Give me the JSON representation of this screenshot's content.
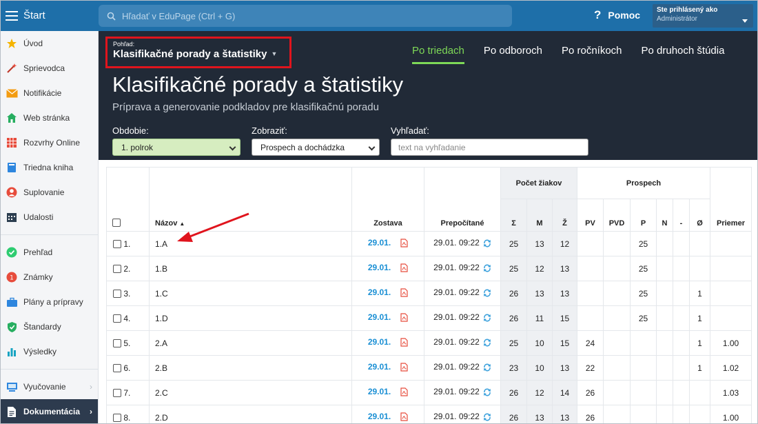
{
  "topbar": {
    "start_label": "Štart",
    "search_placeholder": "Hľadať v EduPage (Ctrl + G)",
    "help_label": "Pomoc",
    "user_line1": "Ste prihlásený ako",
    "user_line2": "Administrátor"
  },
  "sidebar": {
    "items": [
      {
        "label": "Úvod",
        "icon": "star-icon"
      },
      {
        "label": "Sprievodca",
        "icon": "wand-icon"
      },
      {
        "label": "Notifikácie",
        "icon": "envelope-icon"
      },
      {
        "label": "Web stránka",
        "icon": "house-icon"
      },
      {
        "label": "Rozvrhy Online",
        "icon": "timetable-icon"
      },
      {
        "label": "Triedna kniha",
        "icon": "book-icon"
      },
      {
        "label": "Suplovanie",
        "icon": "person-icon"
      },
      {
        "label": "Udalosti",
        "icon": "calendar-icon"
      },
      {
        "label": "Prehľad",
        "icon": "check-circle-icon"
      },
      {
        "label": "Známky",
        "icon": "grades-icon"
      },
      {
        "label": "Plány a prípravy",
        "icon": "briefcase-icon"
      },
      {
        "label": "Štandardy",
        "icon": "shield-icon"
      },
      {
        "label": "Výsledky",
        "icon": "bar-chart-icon"
      },
      {
        "label": "Vyučovanie",
        "icon": "classroom-icon"
      },
      {
        "label": "Dokumentácia",
        "icon": "document-icon"
      }
    ]
  },
  "header": {
    "view_small": "Pohľad:",
    "view_title": "Klasifikačné porady a štatistiky",
    "tabs": [
      "Po triedach",
      "Po odboroch",
      "Po ročníkoch",
      "Po druhoch štúdia"
    ],
    "title": "Klasifikačné porady a štatistiky",
    "subtitle": "Príprava a generovanie podkladov pre klasifikačnú poradu",
    "filters": {
      "obdobie_label": "Obdobie:",
      "obdobie_value": "1. polrok",
      "zobrazit_label": "Zobraziť:",
      "zobrazit_value": "Prospech a dochádzka",
      "vyhladat_label": "Vyhľadať:",
      "vyhladat_placeholder": "text na vyhľadanie"
    }
  },
  "table": {
    "group_pocet": "Počet žiakov",
    "group_prospech": "Prospech",
    "columns": {
      "nazov": "Názov",
      "zostava": "Zostava",
      "prepocitane": "Prepočítané",
      "sum": "Σ",
      "m": "M",
      "z": "Ž",
      "pv": "PV",
      "pvd": "PVD",
      "p": "P",
      "n": "N",
      "dash": "-",
      "avg_sym": "Ø",
      "priemer": "Priemer"
    },
    "rows": [
      {
        "num": "1.",
        "name": "1.A",
        "zostava": "29.01.",
        "prepocitane": "29.01. 09:22",
        "sum": "25",
        "m": "13",
        "z": "12",
        "pv": "",
        "pvd": "",
        "p": "25",
        "n": "",
        "dash": "",
        "avg": "",
        "priemer": ""
      },
      {
        "num": "2.",
        "name": "1.B",
        "zostava": "29.01.",
        "prepocitane": "29.01. 09:22",
        "sum": "25",
        "m": "12",
        "z": "13",
        "pv": "",
        "pvd": "",
        "p": "25",
        "n": "",
        "dash": "",
        "avg": "",
        "priemer": ""
      },
      {
        "num": "3.",
        "name": "1.C",
        "zostava": "29.01.",
        "prepocitane": "29.01. 09:22",
        "sum": "26",
        "m": "13",
        "z": "13",
        "pv": "",
        "pvd": "",
        "p": "25",
        "n": "",
        "dash": "",
        "avg": "1",
        "priemer": ""
      },
      {
        "num": "4.",
        "name": "1.D",
        "zostava": "29.01.",
        "prepocitane": "29.01. 09:22",
        "sum": "26",
        "m": "11",
        "z": "15",
        "pv": "",
        "pvd": "",
        "p": "25",
        "n": "",
        "dash": "",
        "avg": "1",
        "priemer": ""
      },
      {
        "num": "5.",
        "name": "2.A",
        "zostava": "29.01.",
        "prepocitane": "29.01. 09:22",
        "sum": "25",
        "m": "10",
        "z": "15",
        "pv": "24",
        "pvd": "",
        "p": "",
        "n": "",
        "dash": "",
        "avg": "1",
        "priemer": "1.00"
      },
      {
        "num": "6.",
        "name": "2.B",
        "zostava": "29.01.",
        "prepocitane": "29.01. 09:22",
        "sum": "23",
        "m": "10",
        "z": "13",
        "pv": "22",
        "pvd": "",
        "p": "",
        "n": "",
        "dash": "",
        "avg": "1",
        "priemer": "1.02"
      },
      {
        "num": "7.",
        "name": "2.C",
        "zostava": "29.01.",
        "prepocitane": "29.01. 09:22",
        "sum": "26",
        "m": "12",
        "z": "14",
        "pv": "26",
        "pvd": "",
        "p": "",
        "n": "",
        "dash": "",
        "avg": "",
        "priemer": "1.03"
      },
      {
        "num": "8.",
        "name": "2.D",
        "zostava": "29.01.",
        "prepocitane": "29.01. 09:22",
        "sum": "26",
        "m": "13",
        "z": "13",
        "pv": "26",
        "pvd": "",
        "p": "",
        "n": "",
        "dash": "",
        "avg": "",
        "priemer": "1.00"
      }
    ]
  },
  "colors": {
    "topbar": "#1e6fa9",
    "header": "#212a37",
    "accent_green": "#7ed957",
    "highlight_red": "#e0141d",
    "link_blue": "#1a8fd4"
  }
}
